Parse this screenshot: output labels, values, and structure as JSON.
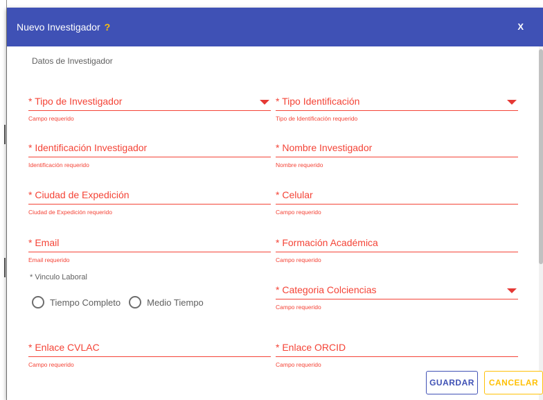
{
  "dialog": {
    "title": "Nuevo Investigador",
    "help": "?",
    "close": "X"
  },
  "section": {
    "title": "Datos de Investigador"
  },
  "fields": {
    "tipo_investigador": {
      "label": "* Tipo de Investigador",
      "error": "Campo requerido"
    },
    "tipo_identificacion": {
      "label": "* Tipo Identificación",
      "error": "Tipo de Identificación requerido"
    },
    "identificacion": {
      "label": "* Identificación Investigador",
      "error": "Identificación requerido"
    },
    "nombre": {
      "label": "* Nombre Investigador",
      "error": "Nombre requerido"
    },
    "ciudad_expedicion": {
      "label": "* Ciudad de Expedición",
      "error": "Ciudad de Expedición requerido"
    },
    "celular": {
      "label": "* Celular",
      "error": "Campo requerido"
    },
    "email": {
      "label": "* Email",
      "error": "Email requerido"
    },
    "formacion_academica": {
      "label": "* Formación Académica",
      "error": "Campo requerido"
    },
    "categoria_colciencias": {
      "label": "* Categoria Colciencias",
      "error": "Campo requerido"
    },
    "enlace_cvlac": {
      "label": "* Enlace CVLAC",
      "error": "Campo requerido"
    },
    "enlace_orcid": {
      "label": "* Enlace ORCID",
      "error": "Campo requerido"
    }
  },
  "vinculo": {
    "label": "* Vinculo Laboral",
    "options": [
      "Tiempo Completo",
      "Medio Tiempo"
    ]
  },
  "buttons": {
    "save": "GUARDAR",
    "cancel": "CANCELAR"
  },
  "colors": {
    "header": "#3f51b5",
    "help": "#ffc107",
    "error": "#f44336",
    "save": "#3f51b5",
    "cancel": "#ffc107"
  }
}
